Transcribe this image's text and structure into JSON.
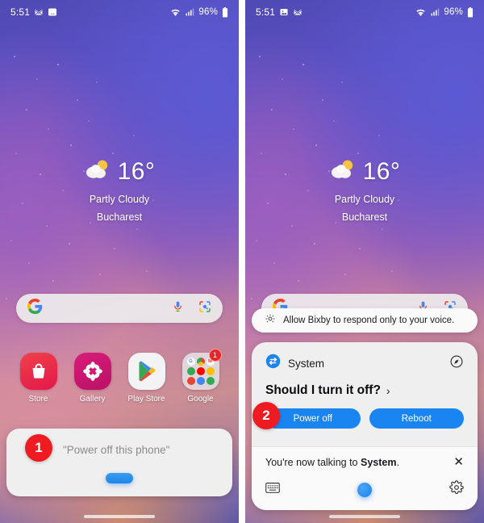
{
  "status_bar": {
    "time": "5:51",
    "battery_percent": "96%",
    "icons_left": [
      "messages-icon",
      "gallery-notification-icon"
    ],
    "icons_right": [
      "wifi-icon",
      "signal-icon",
      "battery-icon"
    ]
  },
  "weather": {
    "temperature": "16°",
    "condition": "Partly Cloudy",
    "city": "Bucharest",
    "icon": "partly-cloudy-icon"
  },
  "search": {
    "placeholder": "",
    "value": "",
    "logo": "google-g-logo",
    "mic": "microphone-icon",
    "lens": "google-lens-icon"
  },
  "dock": {
    "apps": [
      {
        "label": "Store",
        "icon": "galaxy-store-icon"
      },
      {
        "label": "Gallery",
        "icon": "gallery-flower-icon"
      },
      {
        "label": "Play Store",
        "icon": "play-store-icon"
      },
      {
        "label": "Google",
        "icon": "google-folder-icon",
        "badge": "1"
      }
    ]
  },
  "left_panel": {
    "step_badge": "1",
    "prompt_text": "\"Power off this phone\"",
    "listening_indicator": "bixby-listening-pill"
  },
  "right_panel": {
    "step_badge": "2",
    "tip": {
      "icon": "lightbulb-tip-icon",
      "text": "Allow Bixby to respond only to your voice."
    },
    "card": {
      "app_icon": "system-sync-icon",
      "app_name": "System",
      "explore_icon": "explore-compass-icon",
      "question": "Should I turn it off?",
      "question_chevron": "›",
      "buttons": [
        {
          "label": "Power off",
          "name": "power-off-button"
        },
        {
          "label": "Reboot",
          "name": "reboot-button"
        }
      ]
    },
    "footer": {
      "talking_prefix": "You're now talking to ",
      "talking_target": "System",
      "talking_suffix": ".",
      "close_icon": "close-x-icon",
      "keyboard_icon": "keyboard-icon",
      "mic_indicator": "bixby-mic-dot",
      "settings_icon": "gear-icon"
    }
  },
  "nav_bar": {
    "gesture_handle": "home-gesture-pill"
  },
  "colors": {
    "accent_blue": "#1a85f0",
    "badge_red": "#ee1c22",
    "card_bg": "#f0eff0",
    "wallpaper_top": "#4f4ab4",
    "wallpaper_mid": "#a05fb4",
    "wallpaper_bottom": "#c98a6a"
  }
}
